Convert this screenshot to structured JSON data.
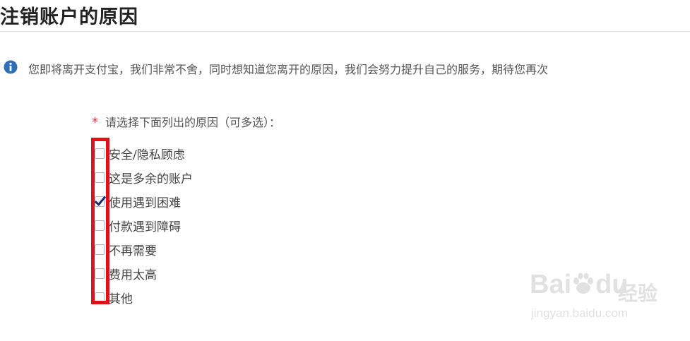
{
  "header": {
    "title": "注销账户的原因"
  },
  "info": {
    "icon": "info-icon",
    "icon_color": "#2e6fb7",
    "text": "您即将离开支付宝，我们非常不舍，同时想知道您离开的原因，我们会努力提升自己的服务，期待您再次"
  },
  "form": {
    "required_mark": "*",
    "question": "请选择下面列出的原因（可多选）：",
    "reasons": [
      {
        "label": "安全/隐私顾虑",
        "checked": false
      },
      {
        "label": "这是多余的账户",
        "checked": false
      },
      {
        "label": "使用遇到困难",
        "checked": true
      },
      {
        "label": "付款遇到障碍",
        "checked": false
      },
      {
        "label": "不再需要",
        "checked": false
      },
      {
        "label": "费用太高",
        "checked": false
      },
      {
        "label": "其他",
        "checked": false
      }
    ]
  },
  "annotation": {
    "highlight_color": "#e01218"
  },
  "watermark": {
    "logo_text_1": "Bai",
    "logo_text_2": "du",
    "brand_cn": "经验",
    "url": "jingyan.baidu.com"
  }
}
